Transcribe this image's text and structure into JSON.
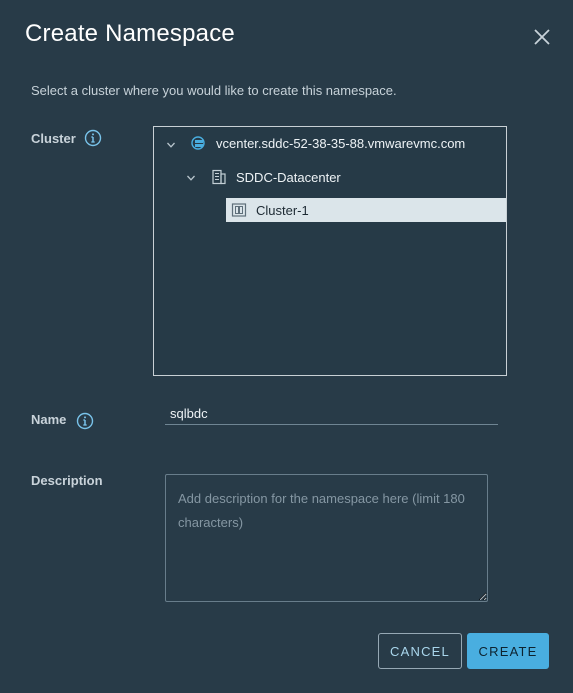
{
  "dialog": {
    "title": "Create Namespace",
    "subtitle": "Select a cluster where you would like to create this namespace."
  },
  "form": {
    "cluster_label": "Cluster",
    "name_label": "Name",
    "name_value": "sqlbdc",
    "description_label": "Description",
    "description_placeholder": "Add description for the namespace here (limit 180 characters)"
  },
  "tree": {
    "vcenter": "vcenter.sddc-52-38-35-88.vmwarevmc.com",
    "datacenter": "SDDC-Datacenter",
    "cluster": "Cluster-1"
  },
  "buttons": {
    "cancel": "CANCEL",
    "create": "CREATE"
  },
  "colors": {
    "background": "#283b48",
    "accent": "#49aee0",
    "selected_row": "#dbe5ea"
  }
}
